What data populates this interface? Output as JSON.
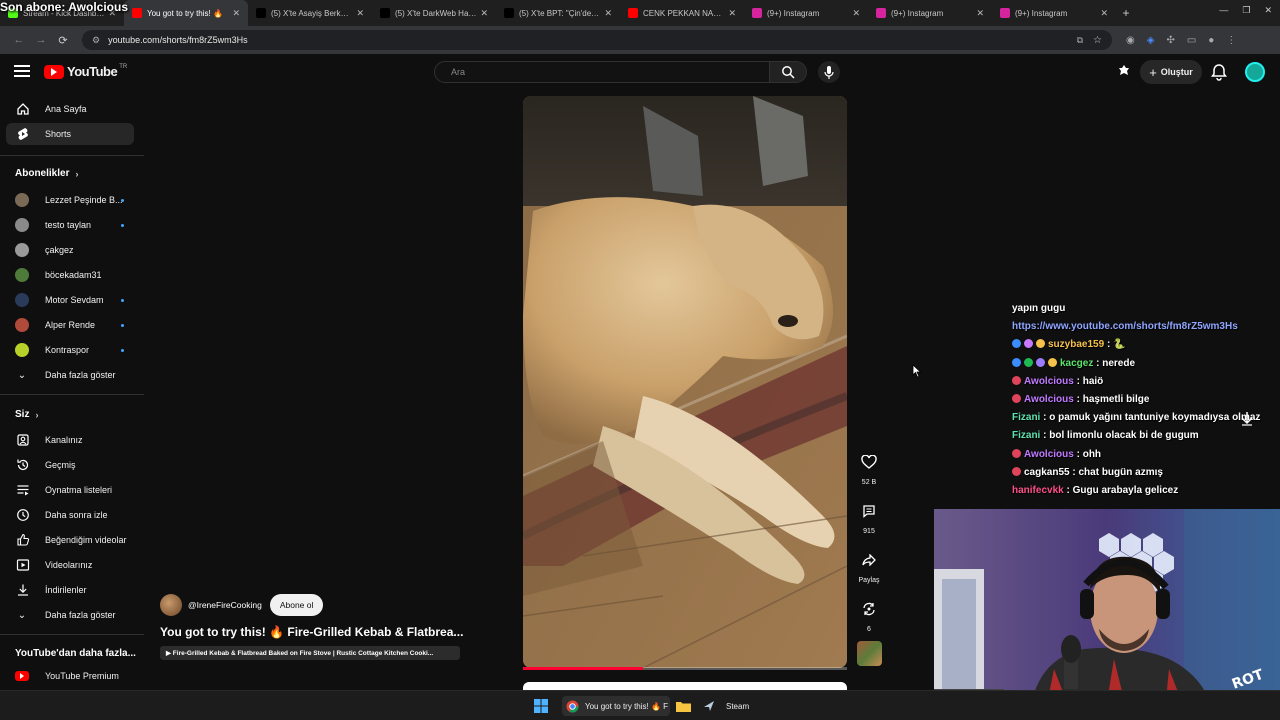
{
  "stream": {
    "last_subscriber": "Son abone: Awolcious"
  },
  "browser": {
    "tabs": [
      {
        "title": "Stream - Kick Dashboard",
        "favicon_color": "#53fc18",
        "active": false
      },
      {
        "title": "You got to try this! 🔥",
        "favicon_color": "#ff0000",
        "active": true
      },
      {
        "title": "(5) X'te Asayiş Berkemal",
        "favicon_color": "#000000",
        "active": false
      },
      {
        "title": "(5) X'te DarkWeb Haber",
        "favicon_color": "#000000",
        "active": false
      },
      {
        "title": "(5) X'te BPT: \"Çin'deki In",
        "favicon_color": "#000000",
        "active": false
      },
      {
        "title": "CENK PEKKAN NASIL ZE",
        "favicon_color": "#ff0000",
        "active": false
      },
      {
        "title": "(9+) Instagram",
        "favicon_color": "#d6249f",
        "active": false
      },
      {
        "title": "(9+) Instagram",
        "favicon_color": "#d6249f",
        "active": false
      },
      {
        "title": "(9+) Instagram",
        "favicon_color": "#d6249f",
        "active": false
      }
    ],
    "url": "youtube.com/shorts/fm8rZ5wm3Hs"
  },
  "youtube": {
    "logo_text": "YouTube",
    "region": "TR",
    "search_placeholder": "Ara",
    "create_label": "Oluştur",
    "nav": [
      {
        "label": "Ana Sayfa",
        "icon": "home-icon"
      },
      {
        "label": "Shorts",
        "icon": "shorts-icon",
        "selected": true
      }
    ],
    "subscriptions_header": "Abonelikler",
    "subscriptions": [
      {
        "name": "Lezzet Peşinde B...",
        "avatar_color": "#7a6a55",
        "new": true
      },
      {
        "name": "testo taylan",
        "avatar_color": "#8a8a8a",
        "new": true
      },
      {
        "name": "çakgez",
        "avatar_color": "#9a9a9a",
        "new": false
      },
      {
        "name": "böcekadam31",
        "avatar_color": "#4e7a3a",
        "new": false
      },
      {
        "name": "Motor Sevdam",
        "avatar_color": "#2a3a5a",
        "new": true
      },
      {
        "name": "Alper Rende",
        "avatar_color": "#b04a3a",
        "new": true
      },
      {
        "name": "Kontraspor",
        "avatar_color": "#b8d02a",
        "new": true
      }
    ],
    "show_more": "Daha fazla göster",
    "you_header": "Siz",
    "you_items": [
      {
        "label": "Kanalınız",
        "icon": "channel-icon"
      },
      {
        "label": "Geçmiş",
        "icon": "history-icon"
      },
      {
        "label": "Oynatma listeleri",
        "icon": "playlist-icon"
      },
      {
        "label": "Daha sonra izle",
        "icon": "watch-later-icon"
      },
      {
        "label": "Beğendiğim videolar",
        "icon": "like-icon"
      },
      {
        "label": "Videolarınız",
        "icon": "your-videos-icon"
      },
      {
        "label": "İndirilenler",
        "icon": "download-icon"
      }
    ],
    "more_from_header": "YouTube'dan daha fazla...",
    "premium_label": "YouTube Premium"
  },
  "short": {
    "channel": "@IreneFireCooking",
    "subscribe_label": "Abone ol",
    "title": "You got to try this! 🔥 Fire-Grilled Kebab & Flatbrea...",
    "chip": "▶ Fire-Grilled Kebab & Flatbread Baked on Fire Stove | Rustic Cottage Kitchen Cooki...",
    "likes": "52 B",
    "comments": "915",
    "share_label": "Paylaş",
    "remix_count": "6",
    "progress": 0.37
  },
  "chat": [
    {
      "user": "",
      "user_color": "#ffffff",
      "text": "yapın gugu",
      "badges": []
    },
    {
      "user": "",
      "user_color": "#ffffff",
      "text": "",
      "link": "https://www.youtube.com/shorts/fm8rZ5wm3Hs",
      "badges": []
    },
    {
      "user": "suzybae159",
      "user_color": "#f5c14a",
      "text": ": 🐍",
      "badges": [
        "#3a8cff",
        "#c87aff",
        "#f5c14a"
      ]
    },
    {
      "user": "kacgez",
      "user_color": "#5ee36c",
      "text": ": nerede",
      "badges": [
        "#3a8cff",
        "#1fb954",
        "#9b7bff",
        "#f5c14a"
      ]
    },
    {
      "user": "Awolcious",
      "user_color": "#c07aff",
      "text": ": haiö",
      "badges": [
        "#e0445a"
      ]
    },
    {
      "user": "Awolcious",
      "user_color": "#c07aff",
      "text": ": haşmetli bilge",
      "badges": [
        "#e0445a"
      ]
    },
    {
      "user": "Fizani",
      "user_color": "#5ee3b0",
      "text": ": o pamuk yağını tantuniye koymadıysa olmaz",
      "badges": []
    },
    {
      "user": "Fizani",
      "user_color": "#5ee3b0",
      "text": ": bol limonlu olacak bi de gugum",
      "badges": []
    },
    {
      "user": "Awolcious",
      "user_color": "#c07aff",
      "text": ": ohh",
      "badges": [
        "#e0445a"
      ]
    },
    {
      "user": "cagkan55",
      "user_color": "#ffffff",
      "text": ": chat bugün azmış",
      "badges": [
        "#e0445a"
      ]
    },
    {
      "user": "hanifecvkk",
      "user_color": "#ff4f8a",
      "text": ": Gugu arabayla gelicez",
      "badges": []
    }
  ],
  "taskbar": {
    "chrome_label": "You got to try this! 🔥 F",
    "steam_label": "Steam"
  }
}
